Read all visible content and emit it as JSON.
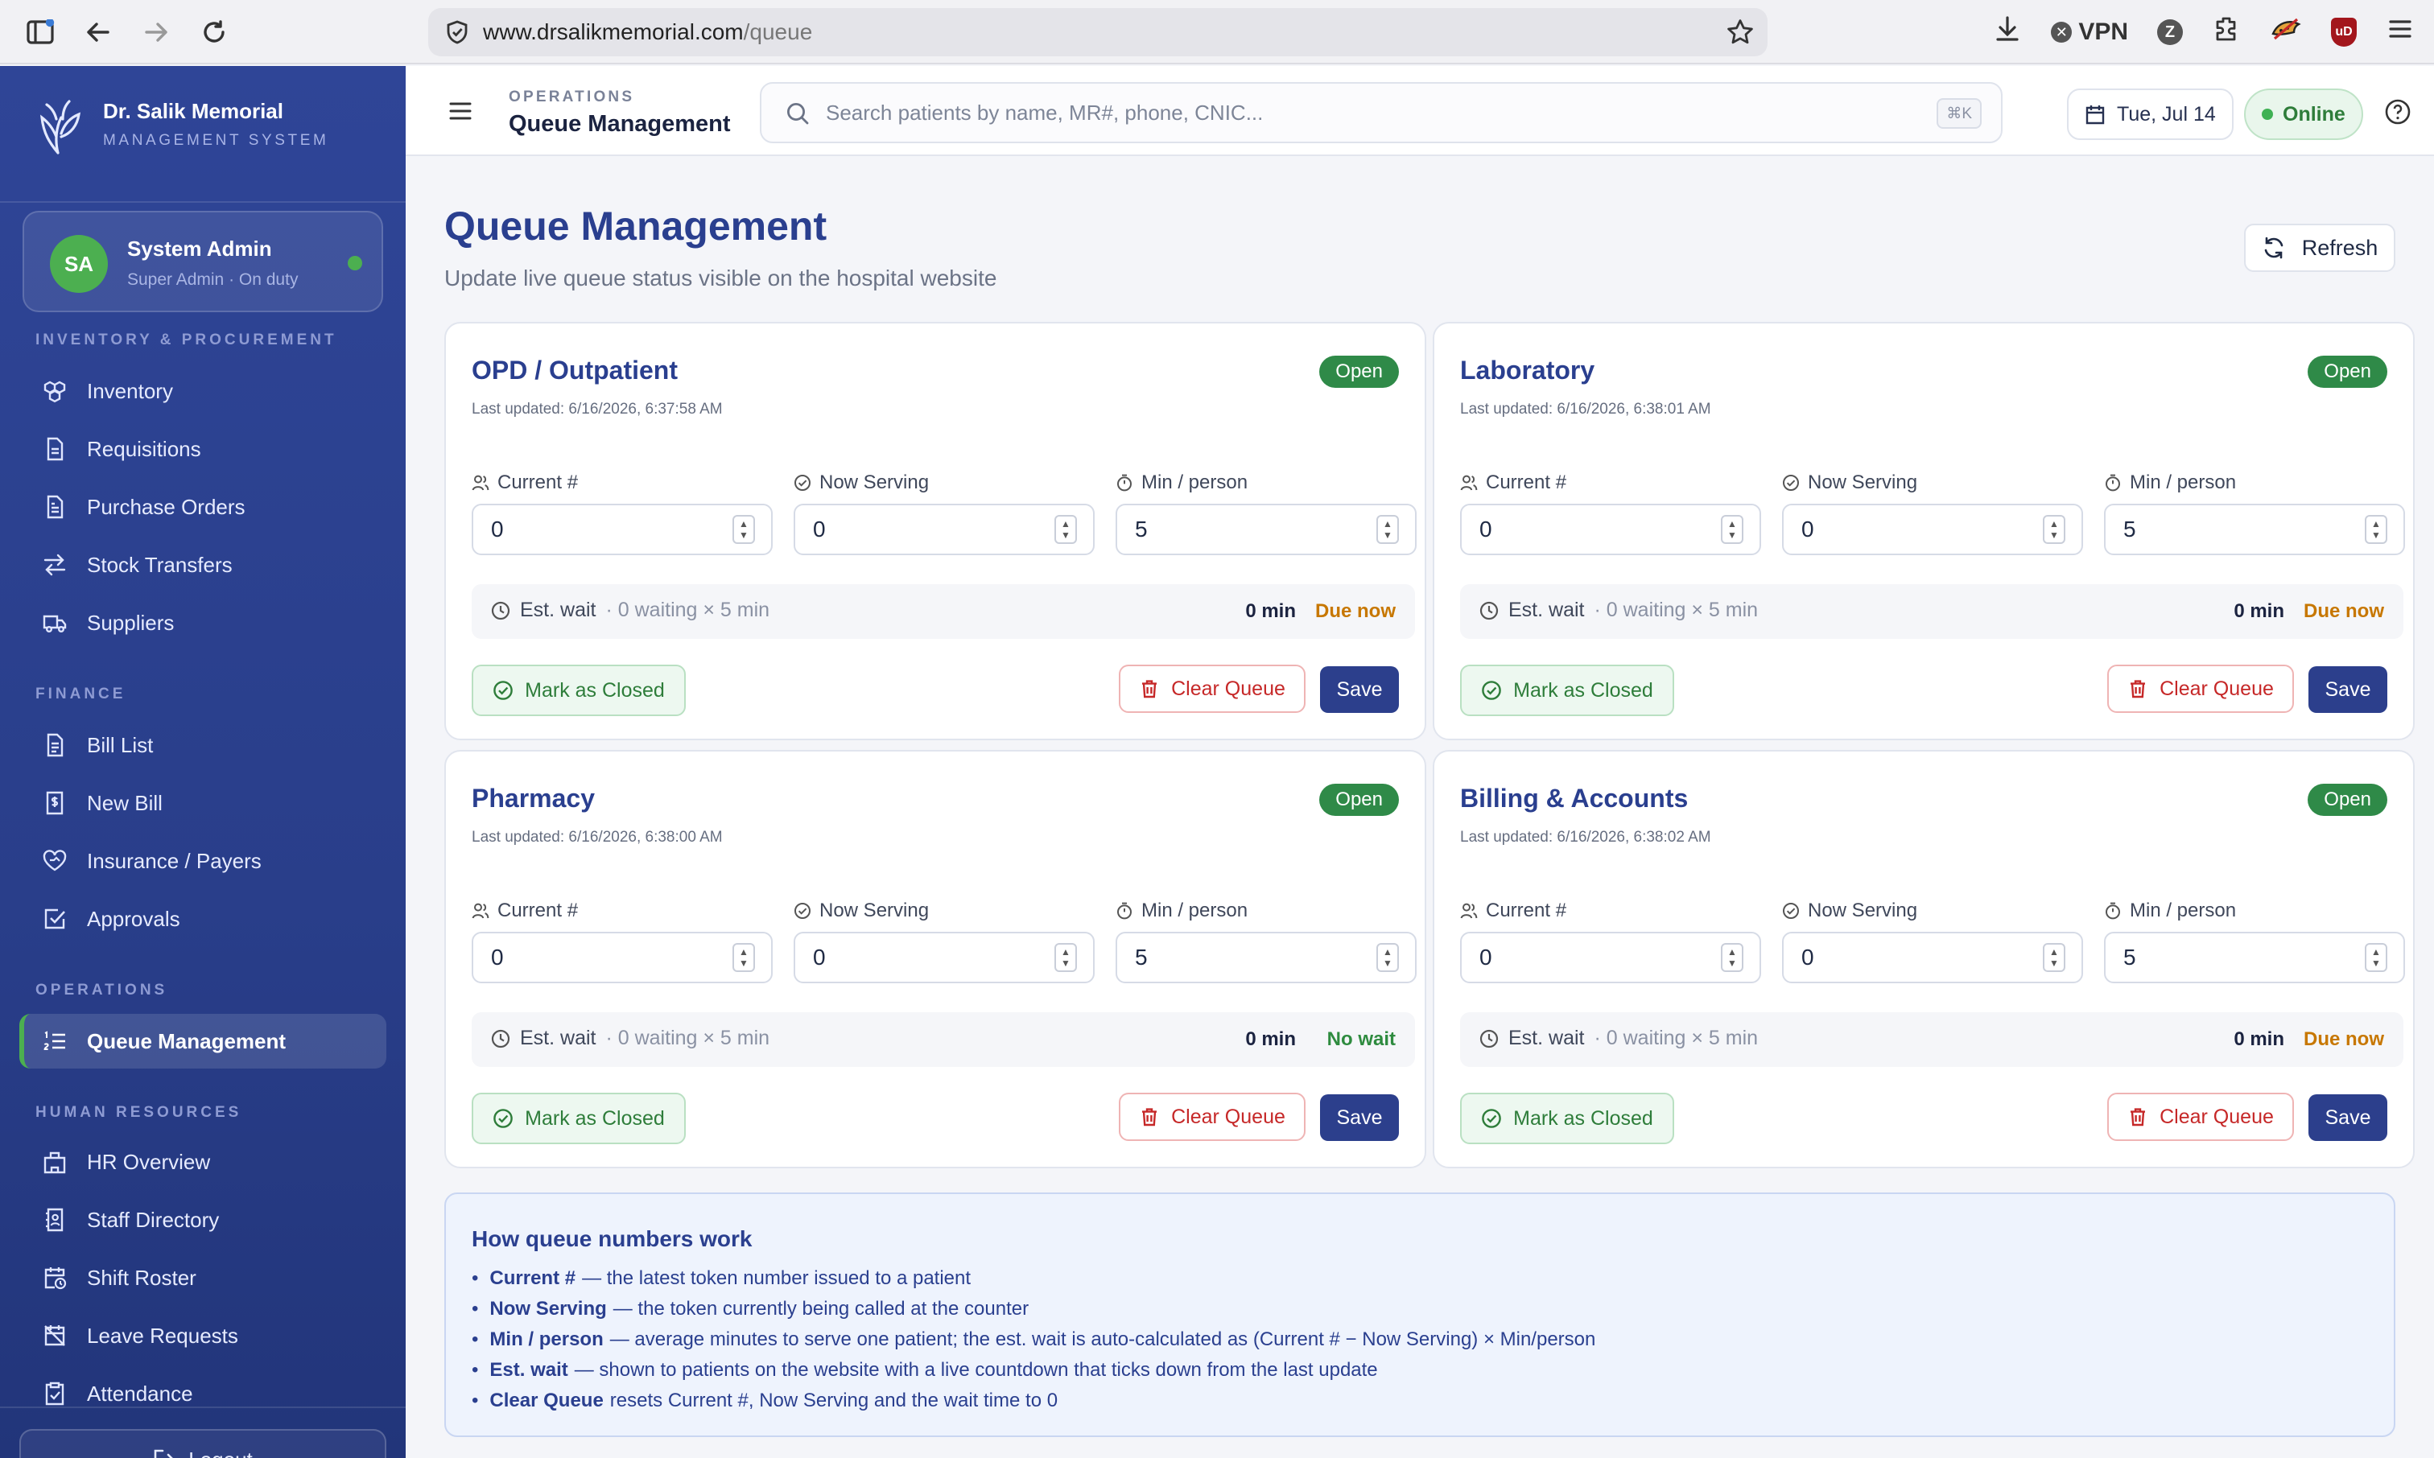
{
  "browser": {
    "url_domain": "www.drsalikmemorial.com",
    "url_path": "/queue",
    "vpn_label": "VPN",
    "z_label": "Z",
    "ublock_label": "uD"
  },
  "sidebar": {
    "brand_title": "Dr. Salik Memorial",
    "brand_subtitle": "MANAGEMENT SYSTEM",
    "user": {
      "initials": "SA",
      "name": "System Admin",
      "role": "Super Admin · On duty"
    },
    "sections": {
      "inventory": "INVENTORY & PROCUREMENT",
      "finance": "FINANCE",
      "operations": "OPERATIONS",
      "hr": "HUMAN RESOURCES"
    },
    "items": {
      "inventory": "Inventory",
      "requisitions": "Requisitions",
      "purchase_orders": "Purchase Orders",
      "stock_transfers": "Stock Transfers",
      "suppliers": "Suppliers",
      "bill_list": "Bill List",
      "new_bill": "New Bill",
      "insurance": "Insurance / Payers",
      "approvals": "Approvals",
      "queue": "Queue Management",
      "hr_overview": "HR Overview",
      "staff_directory": "Staff Directory",
      "shift_roster": "Shift Roster",
      "leave_requests": "Leave Requests",
      "attendance": "Attendance"
    },
    "logout": "Logout"
  },
  "header": {
    "breadcrumb_section": "OPERATIONS",
    "breadcrumb_title": "Queue Management",
    "search_placeholder": "Search patients by name, MR#, phone, CNIC...",
    "search_shortcut": "⌘K",
    "date": "Tue, Jul 14",
    "status": "Online"
  },
  "page": {
    "title": "Queue Management",
    "subtitle": "Update live queue status visible on the hospital website",
    "refresh_label": "Refresh"
  },
  "labels": {
    "current": "Current #",
    "serving": "Now Serving",
    "min_person": "Min / person",
    "est_wait": "Est. wait",
    "mark_closed": "Mark as Closed",
    "clear_queue": "Clear Queue",
    "save": "Save"
  },
  "queues": [
    {
      "name": "OPD / Outpatient",
      "status": "Open",
      "updated": "Last updated: 6/16/2026, 6:37:58 AM",
      "current": "0",
      "serving": "0",
      "min_person": "5",
      "detail": "· 0 waiting × 5 min",
      "wait": "0 min",
      "wait_status": "Due now"
    },
    {
      "name": "Laboratory",
      "status": "Open",
      "updated": "Last updated: 6/16/2026, 6:38:01 AM",
      "current": "0",
      "serving": "0",
      "min_person": "5",
      "detail": "· 0 waiting × 5 min",
      "wait": "0 min",
      "wait_status": "Due now"
    },
    {
      "name": "Pharmacy",
      "status": "Open",
      "updated": "Last updated: 6/16/2026, 6:38:00 AM",
      "current": "0",
      "serving": "0",
      "min_person": "5",
      "detail": "· 0 waiting × 5 min",
      "wait": "0 min",
      "wait_status": "No wait"
    },
    {
      "name": "Billing & Accounts",
      "status": "Open",
      "updated": "Last updated: 6/16/2026, 6:38:02 AM",
      "current": "0",
      "serving": "0",
      "min_person": "5",
      "detail": "· 0 waiting × 5 min",
      "wait": "0 min",
      "wait_status": "Due now"
    }
  ],
  "info": {
    "title": "How queue numbers work",
    "items": [
      {
        "term": "Current #",
        "text": "— the latest token number issued to a patient"
      },
      {
        "term": "Now Serving",
        "text": "— the token currently being called at the counter"
      },
      {
        "term": "Min / person",
        "text": "— average minutes to serve one patient; the est. wait is auto-calculated as (Current # − Now Serving) × Min/person"
      },
      {
        "term": "Est. wait",
        "text": "— shown to patients on the website with a live countdown that ticks down from the last update"
      },
      {
        "term": "Clear Queue",
        "text": "resets Current #, Now Serving and the wait time to 0"
      }
    ]
  },
  "colors": {
    "sidebar": "#2f4597",
    "accent": "#2a3f8f",
    "open_badge": "#2f8a48",
    "due_now": "#c77700",
    "no_wait": "#2e8b3f",
    "danger": "#c62828"
  }
}
